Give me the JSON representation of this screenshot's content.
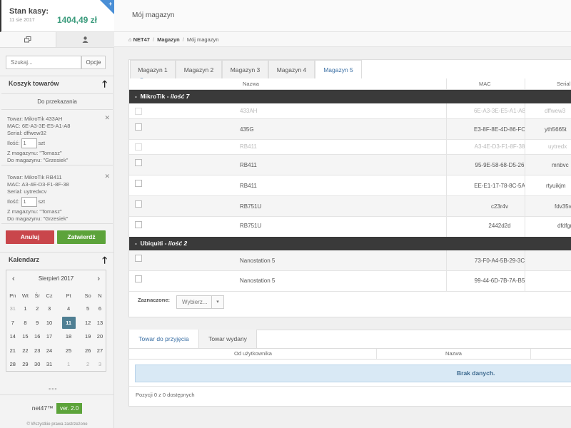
{
  "sidebar": {
    "cash": {
      "label": "Stan kasy:",
      "date": "11 sie 2017",
      "amount": "1404,49 zł",
      "plus": "+"
    },
    "search": {
      "placeholder": "Szukaj...",
      "options_label": "Opcje"
    },
    "cart": {
      "title": "Koszyk towarów",
      "subheading": "Do przekazania",
      "items": [
        {
          "product": "Towar: MikroTik 433AH",
          "mac": "MAC: 6E-A3-3E-E5-A1-A8",
          "serial": "Serial: dffwew32",
          "qty_label": "Ilość:",
          "qty": "1",
          "unit": "szt",
          "from": "Z magazynu: \"Tomasz\"",
          "to": "Do magazynu: \"Grzesiek\""
        },
        {
          "product": "Towar: MikroTik RB411",
          "mac": "MAC: A3-4E-D3-F1-8F-38",
          "serial": "Serial: uytredxcv",
          "qty_label": "Ilość:",
          "qty": "1",
          "unit": "szt",
          "from": "Z magazynu: \"Tomasz\"",
          "to": "Do magazynu: \"Grzesiek\""
        }
      ],
      "cancel_label": "Anuluj",
      "confirm_label": "Zatwierdź"
    },
    "calendar": {
      "title": "Kalendarz",
      "month": "Sierpień 2017",
      "weekdays": [
        "Pn",
        "Wt",
        "Śr",
        "Cz",
        "Pt",
        "So",
        "N"
      ],
      "weeks": [
        [
          "31",
          "1",
          "2",
          "3",
          "4",
          "5",
          "6"
        ],
        [
          "7",
          "8",
          "9",
          "10",
          "11",
          "12",
          "13"
        ],
        [
          "14",
          "15",
          "16",
          "17",
          "18",
          "19",
          "20"
        ],
        [
          "21",
          "22",
          "23",
          "24",
          "25",
          "26",
          "27"
        ],
        [
          "28",
          "29",
          "30",
          "31",
          "1",
          "2",
          "3"
        ]
      ],
      "selected": "11"
    },
    "footer": {
      "name": "net47™",
      "version": "ver. 2.0",
      "copyright": "© Wszystkie prawa zastrzeżone"
    }
  },
  "header": {
    "title": "Mój magazyn"
  },
  "breadcrumb": {
    "home": "NET47",
    "section": "Magazyn",
    "current": "Mój magazyn"
  },
  "warehouse": {
    "tabs": [
      "Magazyn 1",
      "Magazyn 2",
      "Magazyn 3",
      "Magazyn 4",
      "Magazyn 5"
    ],
    "active_tab": "Magazyn 5",
    "columns": {
      "name": "Nazwa",
      "mac": "MAC",
      "serial": "Serial"
    },
    "groups": [
      {
        "brand": "MikroTik",
        "count_label": "ilość 7",
        "rows": [
          {
            "name": "433AH",
            "mac": "6E-A3-3E-E5-A1-A8",
            "serial": "dffwew3",
            "dim": true
          },
          {
            "name": "435G",
            "mac": "E3-8F-8E-4D-86-FC",
            "serial": "yth5665t"
          },
          {
            "name": "RB411",
            "mac": "A3-4E-D3-F1-8F-38",
            "serial": "uytredx",
            "dim": true
          },
          {
            "name": "RB411",
            "mac": "95-9E-58-68-D5-26",
            "serial": "mnbvc"
          },
          {
            "name": "RB411",
            "mac": "EE-E1-17-78-8C-5A",
            "serial": "rtyuikjm"
          },
          {
            "name": "RB751U",
            "mac": "c23r4v",
            "serial": "fdv35v"
          },
          {
            "name": "RB751U",
            "mac": "2442d2d",
            "serial": "dfdfgr"
          }
        ]
      },
      {
        "brand": "Ubiquiti",
        "count_label": "ilość 2",
        "rows": [
          {
            "name": "Nanostation 5",
            "mac": "73-F0-A4-5B-29-3C",
            "serial": ""
          },
          {
            "name": "Nanostation 5",
            "mac": "99-44-6D-7B-7A-B5",
            "serial": ""
          }
        ]
      }
    ],
    "selected_label": "Zaznaczone:",
    "select_placeholder": "Wybierz..."
  },
  "transfers": {
    "tabs": [
      "Towar do przyjęcia",
      "Towar wydany"
    ],
    "columns": {
      "from_user": "Od użytkownika",
      "name": "Nazwa"
    },
    "empty": "Brak danych.",
    "footer": "Pozycji 0 z 0 dostępnych"
  }
}
